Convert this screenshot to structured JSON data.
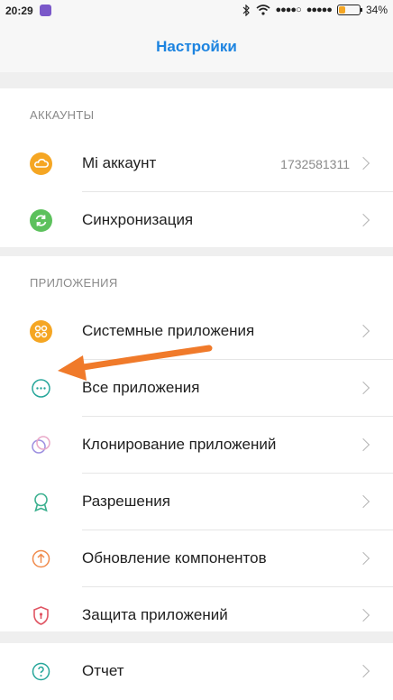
{
  "status_bar": {
    "time": "20:29",
    "battery": "34%",
    "battery_level": 0.34
  },
  "header": {
    "title": "Настройки"
  },
  "accounts": {
    "heading": "АККАУНТЫ",
    "items": [
      {
        "label": "Mi аккаунт",
        "value": "1732581311",
        "icon": "cloud-icon",
        "color": "#f5a623"
      },
      {
        "label": "Синхронизация",
        "icon": "sync-icon",
        "color": "#5cc15c"
      }
    ]
  },
  "apps": {
    "heading": "ПРИЛОЖЕНИЯ",
    "items": [
      {
        "label": "Системные приложения",
        "icon": "grid-icon",
        "color": "#f5a623"
      },
      {
        "label": "Все приложения",
        "icon": "more-dots-icon",
        "color": "#26a69a"
      },
      {
        "label": "Клонирование приложений",
        "icon": "clone-icon",
        "color": "#9c8fe0"
      },
      {
        "label": "Разрешения",
        "icon": "ribbon-icon",
        "color": "#3bb08f"
      },
      {
        "label": "Обновление компонентов",
        "icon": "update-icon",
        "color": "#f08a4b"
      },
      {
        "label": "Защита приложений",
        "icon": "shield-icon",
        "color": "#e05563"
      }
    ]
  },
  "support": {
    "items": [
      {
        "label": "Отчет",
        "icon": "help-icon",
        "color": "#26a69a"
      }
    ]
  },
  "annotation": {
    "arrow_color": "#f07a2a"
  }
}
